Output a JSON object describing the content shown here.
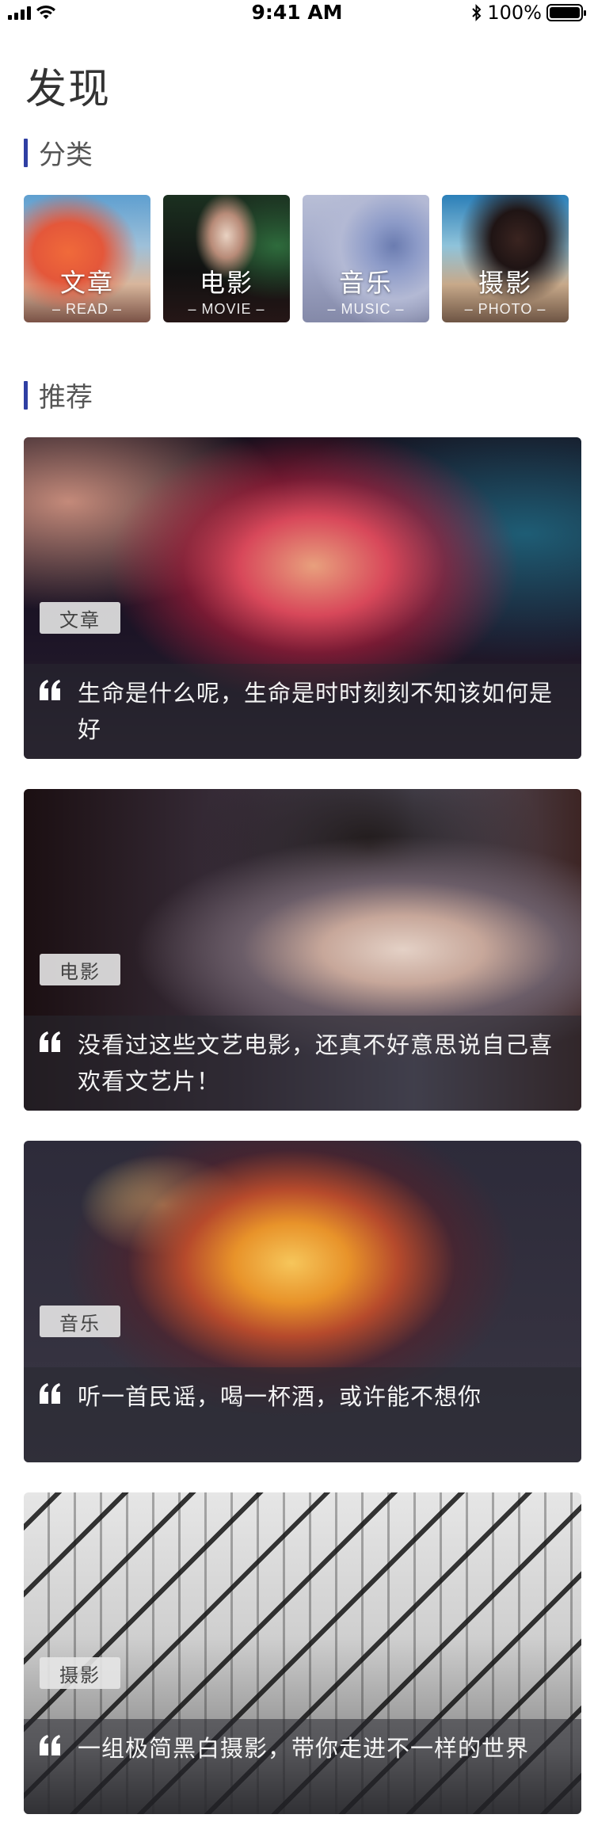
{
  "status_bar": {
    "time": "9:41 AM",
    "battery": "100%"
  },
  "page": {
    "title": "发现"
  },
  "sections": {
    "category_title": "分类",
    "recommend_title": "推荐"
  },
  "categories": [
    {
      "label": "文章",
      "sub": "– READ –"
    },
    {
      "label": "电影",
      "sub": "– MOVIE –"
    },
    {
      "label": "音乐",
      "sub": "– MUSIC –"
    },
    {
      "label": "摄影",
      "sub": "– PHOTO –"
    }
  ],
  "recommendations": [
    {
      "tag": "文章",
      "text": "生命是什么呢，生命是时时刻刻不知该如何是好"
    },
    {
      "tag": "电影",
      "text": "没看过这些文艺电影，还真不好意思说自己喜欢看文艺片！"
    },
    {
      "tag": "音乐",
      "text": "听一首民谣，喝一杯酒，或许能不想你"
    },
    {
      "tag": "摄影",
      "text": "一组极简黑白摄影，带你走进不一样的世界"
    }
  ],
  "colors": {
    "accent": "#2f3fa3",
    "title": "#333333",
    "section_title": "#555555"
  },
  "icons": [
    "signal-icon",
    "wifi-icon",
    "bluetooth-icon",
    "battery-icon",
    "quote-icon"
  ]
}
